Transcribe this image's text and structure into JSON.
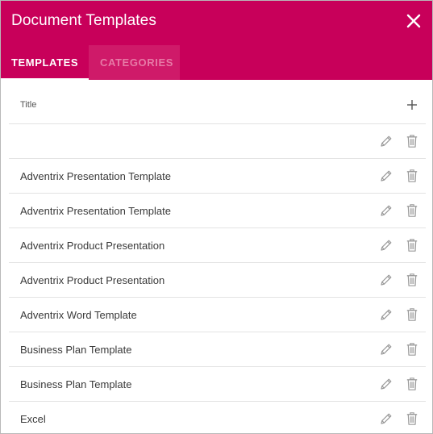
{
  "dialog": {
    "title": "Document Templates",
    "close_icon": "close-icon"
  },
  "tabs": [
    {
      "label": "TEMPLATES",
      "active": true
    },
    {
      "label": "CATEGORIES",
      "active": false
    }
  ],
  "list": {
    "column_title": "Title",
    "add_icon": "plus-icon",
    "rows": [
      {
        "title": ""
      },
      {
        "title": "Adventrix Presentation Template"
      },
      {
        "title": "Adventrix Presentation Template"
      },
      {
        "title": "Adventrix Product Presentation"
      },
      {
        "title": "Adventrix Product Presentation"
      },
      {
        "title": "Adventrix Word Template"
      },
      {
        "title": "Business Plan Template"
      },
      {
        "title": "Business Plan Template"
      },
      {
        "title": "Excel"
      }
    ],
    "row_icons": [
      "pencil-icon",
      "trash-icon"
    ]
  },
  "colors": {
    "header_bg": "#c8005a",
    "inactive_tab_bg": "#cf1a69",
    "inactive_tab_text": "#e77aa6",
    "icon_gray": "#9a9a9a"
  }
}
